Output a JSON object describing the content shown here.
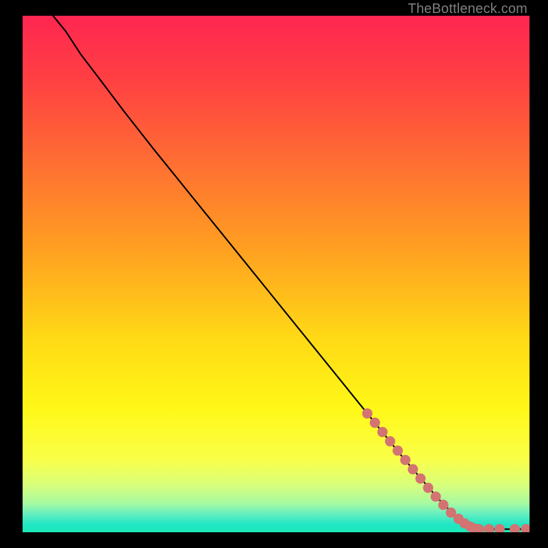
{
  "watermark": "TheBottleneck.com",
  "chart_data": {
    "type": "line",
    "title": "",
    "xlabel": "",
    "ylabel": "",
    "xlim": [
      0,
      100
    ],
    "ylim": [
      0,
      100
    ],
    "background_gradient": {
      "stops": [
        {
          "offset": 0.0,
          "color": "#ff2651"
        },
        {
          "offset": 0.12,
          "color": "#ff3f43"
        },
        {
          "offset": 0.28,
          "color": "#ff6d33"
        },
        {
          "offset": 0.45,
          "color": "#ff9f21"
        },
        {
          "offset": 0.62,
          "color": "#ffd816"
        },
        {
          "offset": 0.76,
          "color": "#fff817"
        },
        {
          "offset": 0.86,
          "color": "#f9ff49"
        },
        {
          "offset": 0.91,
          "color": "#d7ff7e"
        },
        {
          "offset": 0.945,
          "color": "#a5f9a2"
        },
        {
          "offset": 0.965,
          "color": "#63eec0"
        },
        {
          "offset": 0.985,
          "color": "#20e6c4"
        },
        {
          "offset": 1.0,
          "color": "#1de9b6"
        }
      ]
    },
    "series": [
      {
        "name": "curve",
        "type": "line",
        "x": [
          6.0,
          8.5,
          11.5,
          15.0,
          20.0,
          26.0,
          33.0,
          40.0,
          47.0,
          54.0,
          61.0,
          68.0,
          75.0,
          82.0,
          86.0,
          88.0,
          89.5,
          89.7,
          92.0,
          94.0,
          94.5,
          97.0,
          99.3
        ],
        "y": [
          100.0,
          97.0,
          92.5,
          88.0,
          81.5,
          74.0,
          65.5,
          57.0,
          48.5,
          40.0,
          31.5,
          23.0,
          14.5,
          6.5,
          2.5,
          1.2,
          0.6,
          0.6,
          0.6,
          0.6,
          0.6,
          0.6,
          0.6
        ]
      },
      {
        "name": "highlight-points",
        "type": "scatter",
        "color": "#d37372",
        "x": [
          68.0,
          69.5,
          71.0,
          72.5,
          74.0,
          75.5,
          77.0,
          78.5,
          80.0,
          81.5,
          83.0,
          84.5,
          86.0,
          87.2,
          88.3,
          89.2,
          90.0,
          92.0,
          94.1,
          97.1,
          99.3
        ],
        "y": [
          23.0,
          21.2,
          19.4,
          17.6,
          15.8,
          14.0,
          12.2,
          10.4,
          8.6,
          6.9,
          5.3,
          3.8,
          2.6,
          1.7,
          1.1,
          0.7,
          0.6,
          0.6,
          0.6,
          0.6,
          0.6
        ]
      }
    ]
  }
}
